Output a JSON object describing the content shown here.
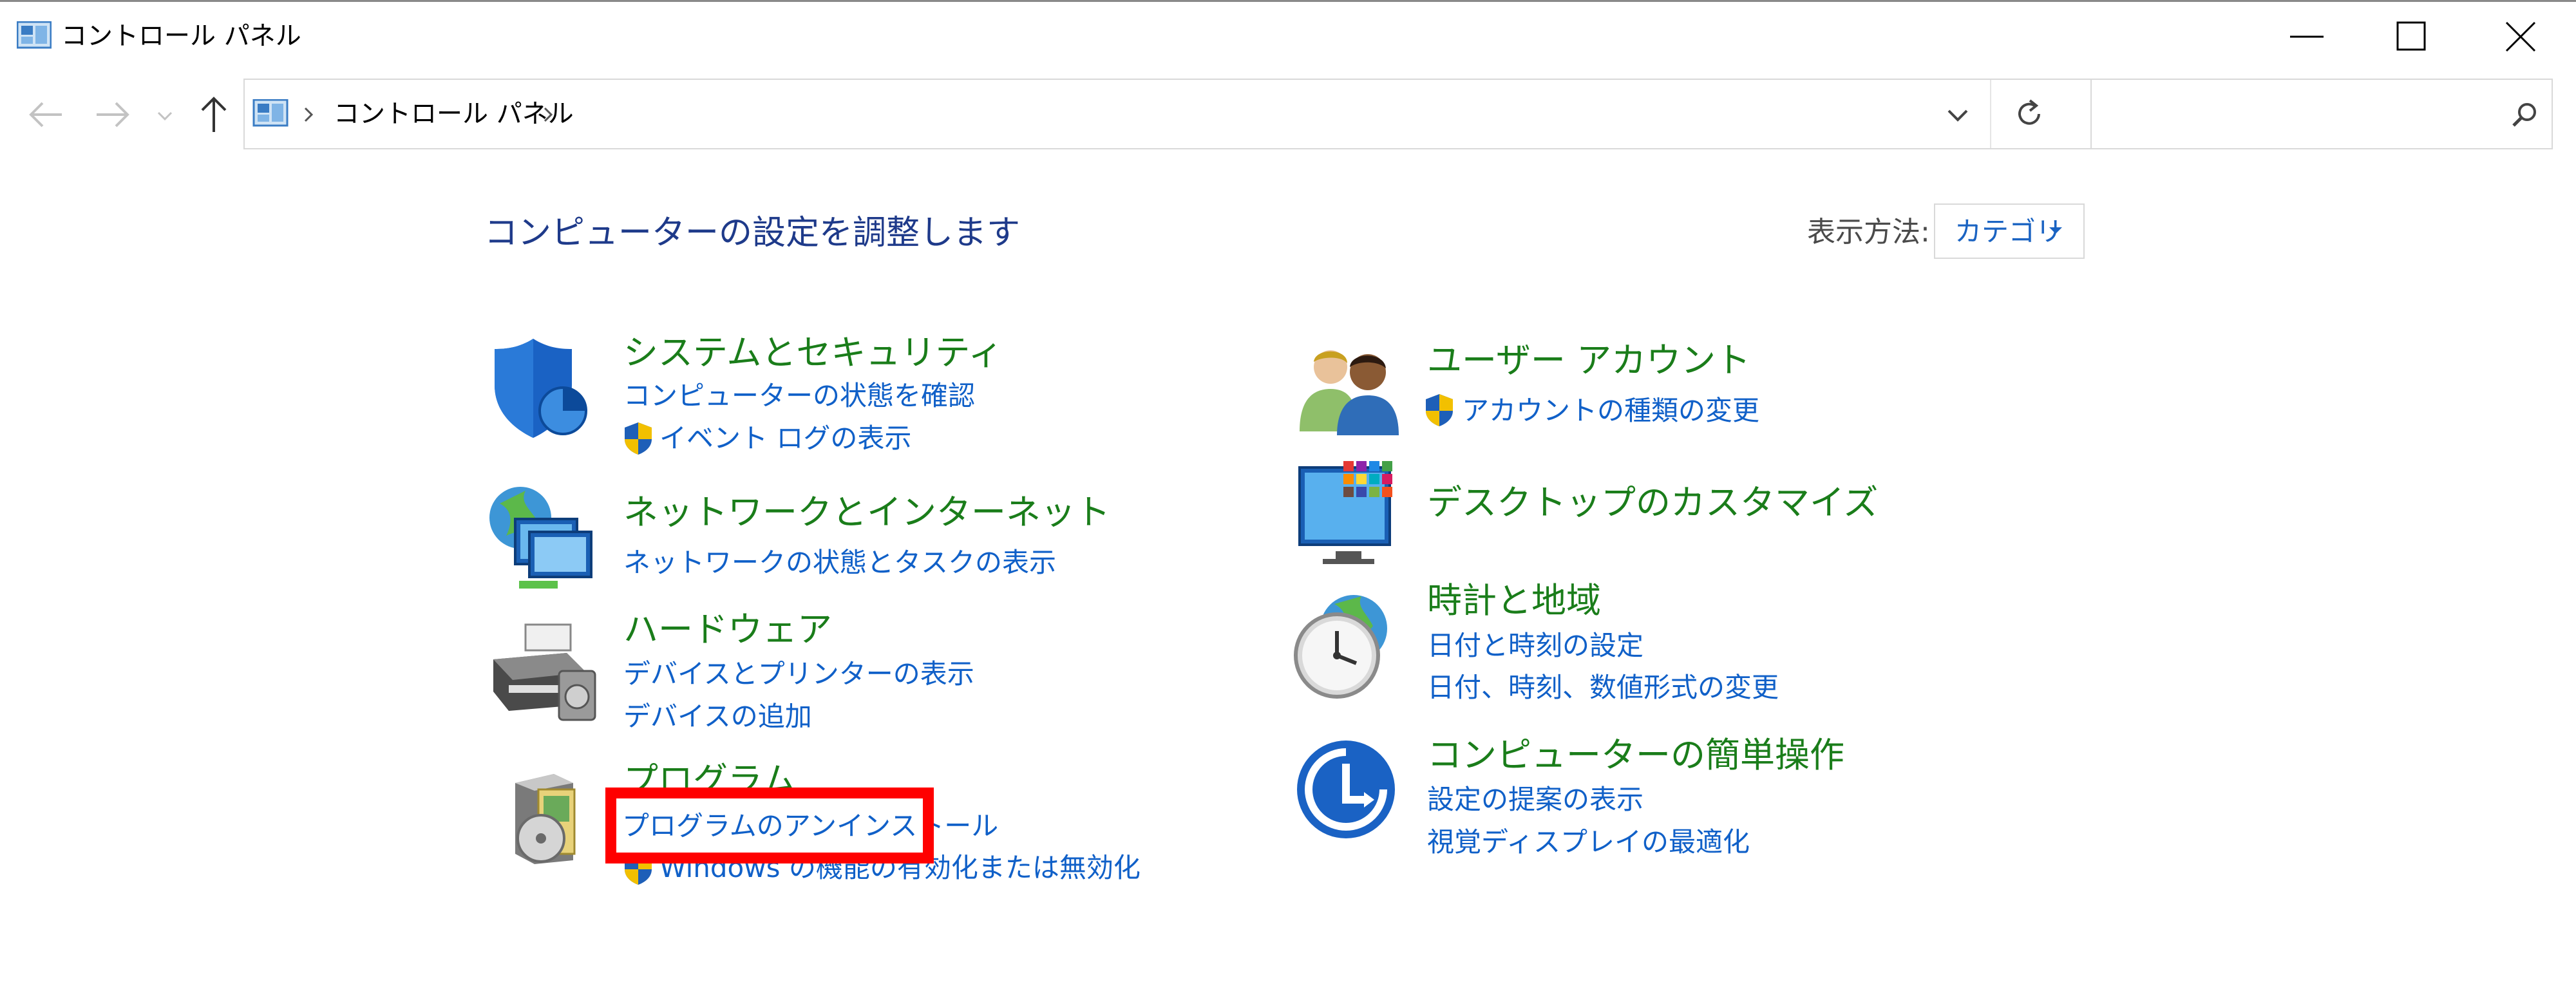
{
  "window": {
    "title": "コントロール パネル"
  },
  "address_bar": {
    "crumb": "コントロール パネル"
  },
  "search": {
    "value": "",
    "placeholder": ""
  },
  "main": {
    "heading": "コンピューターの設定を調整します",
    "view_label": "表示方法:",
    "view_value": "カテゴリ"
  },
  "categories": [
    {
      "title": "システムとセキュリティ",
      "icon": "system-security-icon",
      "links": [
        "コンピューターの状態を確認",
        "イベント ログの表示"
      ]
    },
    {
      "title": "ネットワークとインターネット",
      "icon": "network-icon",
      "links": [
        "ネットワークの状態とタスクの表示"
      ]
    },
    {
      "title": "ハードウェア",
      "icon": "hardware-icon",
      "links": [
        "デバイスとプリンターの表示",
        "デバイスの追加"
      ]
    },
    {
      "title": "プログラム",
      "icon": "programs-icon",
      "links": [
        "プログラムのアンインストール",
        "Windows の機能の有効化または無効化"
      ]
    },
    {
      "title": "ユーザー アカウント",
      "icon": "user-accounts-icon",
      "links": [
        "アカウントの種類の変更"
      ]
    },
    {
      "title": "デスクトップのカスタマイズ",
      "icon": "desktop-customize-icon",
      "links": []
    },
    {
      "title": "時計と地域",
      "icon": "clock-region-icon",
      "links": [
        "日付と時刻の設定",
        "日付、時刻、数値形式の変更"
      ]
    },
    {
      "title": "コンピューターの簡単操作",
      "icon": "ease-of-access-icon",
      "links": [
        "設定の提案の表示",
        "視覚ディスプレイの最適化"
      ]
    }
  ],
  "colors": {
    "category_title": "#1a7d1a",
    "link": "#1060c8",
    "heading": "#1e3a8a",
    "highlight": "#ff0000"
  }
}
